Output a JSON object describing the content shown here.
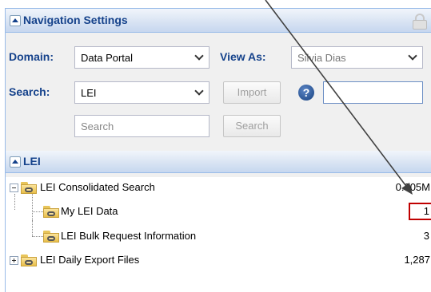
{
  "nav_settings": {
    "title": "Navigation Settings",
    "domain_label": "Domain:",
    "domain_value": "Data Portal",
    "view_as_label": "View As:",
    "view_as_value": "Silvia Dias",
    "search_label": "Search:",
    "search_type_value": "LEI",
    "import_button": "Import",
    "search_placeholder": "Search",
    "search_button": "Search",
    "help_glyph": "?"
  },
  "lei_panel": {
    "title": "LEI",
    "tree": [
      {
        "label": "LEI Consolidated Search",
        "count": "0.305M",
        "expanded": true,
        "level": 0
      },
      {
        "label": "My LEI Data",
        "count": "1",
        "level": 1,
        "highlighted": true
      },
      {
        "label": "LEI Bulk Request Information",
        "count": "3",
        "level": 1
      },
      {
        "label": "LEI Daily Export Files",
        "count": "1,287",
        "expanded": false,
        "level": 0
      }
    ]
  },
  "icons": {
    "toggle": "collapse-toggle-icon",
    "lock": "lock-icon",
    "help": "help-icon",
    "folder": "linked-folder-icon"
  },
  "colors": {
    "header_text": "#15428b",
    "highlight_box": "#c00000",
    "annotation_arrow": "#404040"
  }
}
